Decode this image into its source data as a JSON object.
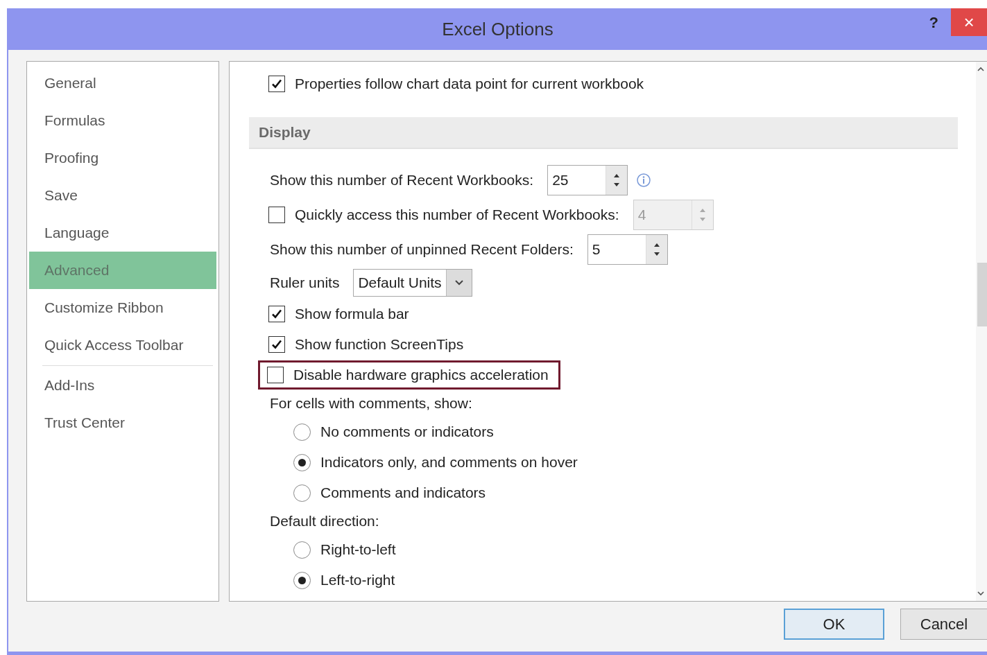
{
  "window": {
    "title": "Excel Options",
    "help": "?",
    "close": "×"
  },
  "sidebar": {
    "groups": [
      {
        "items": [
          {
            "label": "General",
            "selected": false
          },
          {
            "label": "Formulas",
            "selected": false
          },
          {
            "label": "Proofing",
            "selected": false
          },
          {
            "label": "Save",
            "selected": false
          },
          {
            "label": "Language",
            "selected": false
          },
          {
            "label": "Advanced",
            "selected": true
          },
          {
            "label": "Customize Ribbon",
            "selected": false
          },
          {
            "label": "Quick Access Toolbar",
            "selected": false
          }
        ]
      },
      {
        "items": [
          {
            "label": "Add-Ins",
            "selected": false
          },
          {
            "label": "Trust Center",
            "selected": false
          }
        ]
      }
    ]
  },
  "options": [
    {
      "kind": "checkbox",
      "label": "Properties follow chart data point for current workbook",
      "checked": true,
      "highlighted": false
    },
    {
      "kind": "section",
      "label": "Display"
    },
    {
      "kind": "spin",
      "label": "Show this number of Recent Workbooks:",
      "value": "25",
      "disabled": false,
      "info": true
    },
    {
      "kind": "checkspin",
      "label": "Quickly access this number of Recent Workbooks:",
      "checked": false,
      "value": "4",
      "disabled": true
    },
    {
      "kind": "spin",
      "label": "Show this number of unpinned Recent Folders:",
      "value": "5",
      "disabled": false,
      "info": false
    },
    {
      "kind": "select",
      "label": "Ruler units",
      "value": "Default Units"
    },
    {
      "kind": "checkbox",
      "label": "Show formula bar",
      "checked": true,
      "highlighted": false
    },
    {
      "kind": "checkbox",
      "label": "Show function ScreenTips",
      "checked": true,
      "highlighted": false
    },
    {
      "kind": "checkbox",
      "label": "Disable hardware graphics acceleration",
      "checked": false,
      "highlighted": true
    },
    {
      "kind": "label",
      "label": "For cells with comments, show:"
    },
    {
      "kind": "radio",
      "label": "No comments or indicators",
      "selected": false
    },
    {
      "kind": "radio",
      "label": "Indicators only, and comments on hover",
      "selected": true
    },
    {
      "kind": "radio",
      "label": "Comments and indicators",
      "selected": false
    },
    {
      "kind": "label",
      "label": "Default direction:"
    },
    {
      "kind": "radio",
      "label": "Right-to-left",
      "selected": false
    },
    {
      "kind": "radio",
      "label": "Left-to-right",
      "selected": true
    }
  ],
  "buttons": [
    "OK",
    "Cancel"
  ]
}
